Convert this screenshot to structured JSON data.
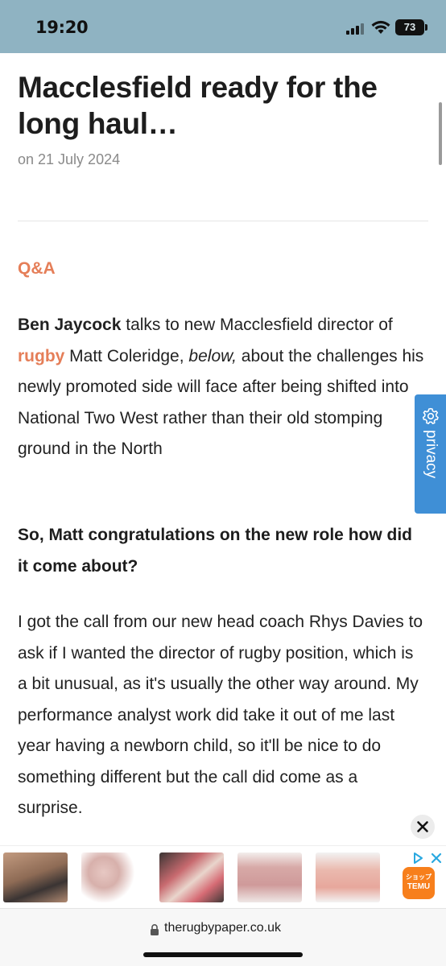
{
  "status_bar": {
    "time": "19:20",
    "battery": "73"
  },
  "article": {
    "headline": "Macclesfield ready for the long haul…",
    "date": "on 21 July 2024",
    "section_label": "Q&A",
    "intro": {
      "author": "Ben Jaycock",
      "text_a": " talks to new Macclesfield director of ",
      "link": "rugby",
      "text_b": " Matt Coleridge, ",
      "emphasis": "below,",
      "text_c": " about the challenges his newly promoted side will face after being shifted into National Two West rather than their old stomping ground in the North"
    },
    "question": "So, Matt congratulations on the new role how did it come about?",
    "answer": "I got the call from our new head coach Rhys Davies to ask if I wanted the director of rugby position, which is a bit unusual, as it's usually the other way around. My performance analyst work did take it out of me last year having a newborn child, so it'll be nice to do something different but the call did come as a surprise."
  },
  "privacy": {
    "label": "privacy"
  },
  "ad": {
    "thumbnails": [
      "sandals-feet",
      "bra-set",
      "floral-sandals",
      "pink-dress",
      "pink-lounge-set"
    ],
    "temu_label_top": "ショップ",
    "temu_label": "TEMU"
  },
  "url_bar": {
    "domain": "therugbypaper.co.uk"
  },
  "colors": {
    "accent": "#e57e58",
    "status_bar": "#8fb3c2",
    "privacy_tab": "#3f8fd6"
  }
}
